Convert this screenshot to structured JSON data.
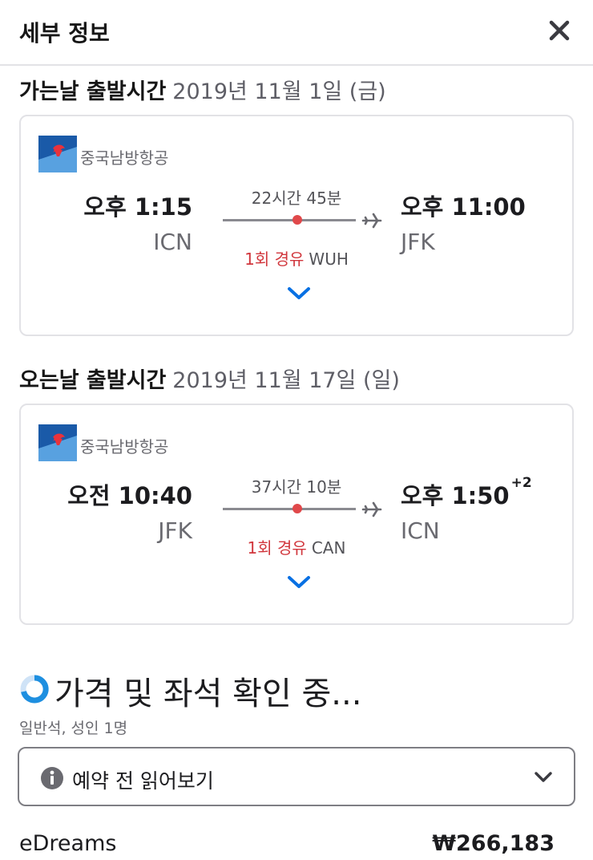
{
  "header": {
    "title": "세부 정보"
  },
  "outbound": {
    "label": "가는날 출발시간",
    "date": "2019년 11월 1일 (금)",
    "airline": "중국남방항공",
    "departure": {
      "time": "오후 1:15",
      "airport": "ICN"
    },
    "arrival": {
      "time": "오후 11:00",
      "airport": "JFK",
      "day_offset": ""
    },
    "duration": "22시간 45분",
    "stops": "1회 경유",
    "stop_airport": "WUH"
  },
  "return": {
    "label": "오는날 출발시간",
    "date": "2019년 11월 17일 (일)",
    "airline": "중국남방항공",
    "departure": {
      "time": "오전 10:40",
      "airport": "JFK"
    },
    "arrival": {
      "time": "오후 1:50",
      "airport": "ICN",
      "day_offset": "+2"
    },
    "duration": "37시간 10분",
    "stops": "1회 경유",
    "stop_airport": "CAN"
  },
  "pricing": {
    "heading": "가격 및 좌석 확인 중...",
    "cabin_info": "일반석, 성인 1명",
    "prebook_label": "예약 전 읽어보기"
  },
  "provider": {
    "name": "eDreams",
    "price": "₩266,183"
  },
  "icons": {
    "close": "close-icon",
    "airline_logo": "china-southern-logo-icon",
    "plane": "plane-icon",
    "expand": "chevron-down-icon",
    "spinner": "loading-spinner-icon",
    "info": "info-icon"
  },
  "colors": {
    "stop_red": "#d1373d",
    "chevron_blue": "#0770e3",
    "logo_blue": "#1a5aa8"
  }
}
